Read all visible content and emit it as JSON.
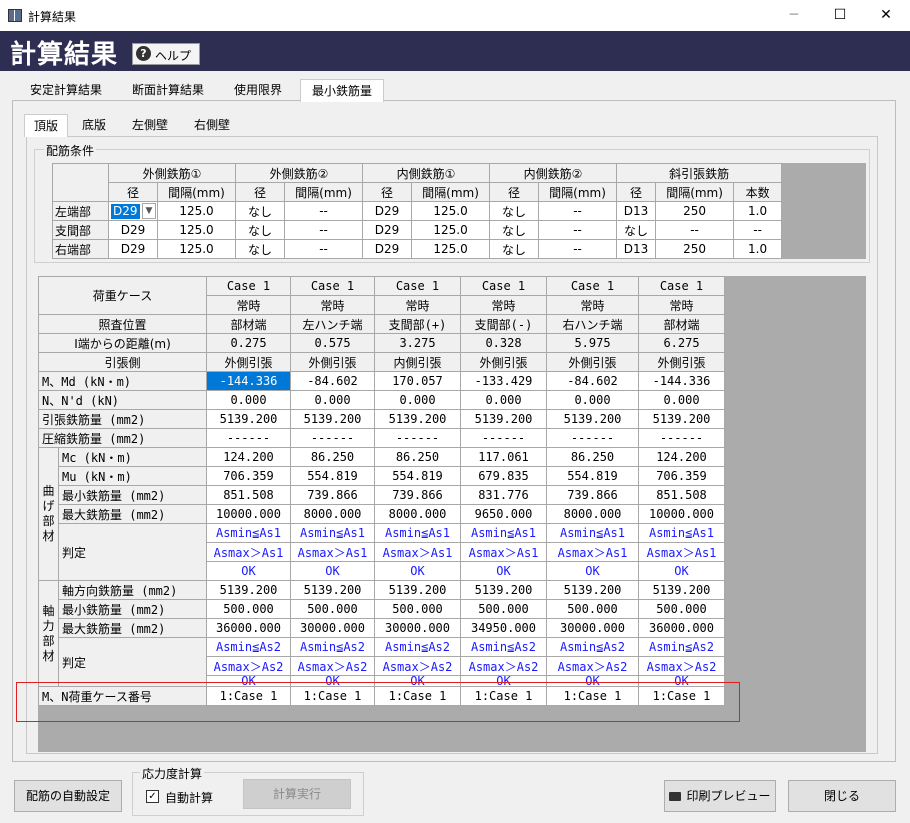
{
  "window": {
    "title": "計算結果",
    "header": "計算結果",
    "help_label": "ヘルプ",
    "minimize": "─",
    "maximize": "☐",
    "close": "✕"
  },
  "main_tabs": [
    "安定計算結果",
    "断面計算結果",
    "使用限界",
    "最小鉄筋量"
  ],
  "sub_tabs": [
    "頂版",
    "底版",
    "左側壁",
    "右側壁"
  ],
  "rebar": {
    "group_label": "配筋条件",
    "groups": [
      "外側鉄筋①",
      "外側鉄筋②",
      "内側鉄筋①",
      "内側鉄筋②",
      "斜引張鉄筋"
    ],
    "sub": {
      "dia": "径",
      "pitch": "間隔(mm)",
      "count": "本数"
    },
    "rows": [
      {
        "label": "左端部",
        "v": [
          "D29",
          "125.0",
          "なし",
          "--",
          "D29",
          "125.0",
          "なし",
          "--",
          "D13",
          "250",
          "1.0"
        ]
      },
      {
        "label": "支間部",
        "v": [
          "D29",
          "125.0",
          "なし",
          "--",
          "D29",
          "125.0",
          "なし",
          "--",
          "なし",
          "--",
          "--"
        ]
      },
      {
        "label": "右端部",
        "v": [
          "D29",
          "125.0",
          "なし",
          "--",
          "D29",
          "125.0",
          "なし",
          "--",
          "D13",
          "250",
          "1.0"
        ]
      }
    ]
  },
  "results": {
    "load_case_label": "荷重ケース",
    "case": [
      "Case 1",
      "Case 1",
      "Case 1",
      "Case 1",
      "Case 1",
      "Case 1"
    ],
    "cond": [
      "常時",
      "常時",
      "常時",
      "常時",
      "常時",
      "常時"
    ],
    "position_label": "照査位置",
    "position": [
      "部材端",
      "左ハンチ端",
      "支間部(+)",
      "支間部(-)",
      "右ハンチ端",
      "部材端"
    ],
    "dist_label": "I端からの距離(m)",
    "dist": [
      "0.275",
      "0.575",
      "3.275",
      "0.328",
      "5.975",
      "6.275"
    ],
    "tension_label": "引張側",
    "tension": [
      "外側引張",
      "外側引張",
      "内側引張",
      "外側引張",
      "外側引張",
      "外側引張"
    ],
    "m_label": "M、Md  (kN・m)",
    "m": [
      "-144.336",
      "-84.602",
      "170.057",
      "-133.429",
      "-84.602",
      "-144.336"
    ],
    "n_label": "N、N'd (kN)",
    "n": [
      "0.000",
      "0.000",
      "0.000",
      "0.000",
      "0.000",
      "0.000"
    ],
    "as_label": "引張鉄筋量 (mm2)",
    "as": [
      "5139.200",
      "5139.200",
      "5139.200",
      "5139.200",
      "5139.200",
      "5139.200"
    ],
    "asc_label": "圧縮鉄筋量 (mm2)",
    "asc": [
      "------",
      "------",
      "------",
      "------",
      "------",
      "------"
    ],
    "bend_section": "曲げ部材",
    "mc_label": "Mc (kN・m)",
    "mc": [
      "124.200",
      "86.250",
      "86.250",
      "117.061",
      "86.250",
      "124.200"
    ],
    "mu_label": "Mu (kN・m)",
    "mu": [
      "706.359",
      "554.819",
      "554.819",
      "679.835",
      "554.819",
      "706.359"
    ],
    "bmin_label": "最小鉄筋量 (mm2)",
    "bmin": [
      "851.508",
      "739.866",
      "739.866",
      "831.776",
      "739.866",
      "851.508"
    ],
    "bmax_label": "最大鉄筋量 (mm2)",
    "bmax": [
      "10000.000",
      "8000.000",
      "8000.000",
      "9650.000",
      "8000.000",
      "10000.000"
    ],
    "judge_label": "判定",
    "bj1": [
      "Asmin≦As1",
      "Asmin≦As1",
      "Asmin≦As1",
      "Asmin≦As1",
      "Asmin≦As1",
      "Asmin≦As1"
    ],
    "bj2": [
      "Asmax＞As1",
      "Asmax＞As1",
      "Asmax＞As1",
      "Asmax＞As1",
      "Asmax＞As1",
      "Asmax＞As1"
    ],
    "bj3": [
      "OK",
      "OK",
      "OK",
      "OK",
      "OK",
      "OK"
    ],
    "axial_section": "軸力部材",
    "ax_label": "軸方向鉄筋量 (mm2)",
    "ax": [
      "5139.200",
      "5139.200",
      "5139.200",
      "5139.200",
      "5139.200",
      "5139.200"
    ],
    "amin_label": "最小鉄筋量  (mm2)",
    "amin": [
      "500.000",
      "500.000",
      "500.000",
      "500.000",
      "500.000",
      "500.000"
    ],
    "amax_label": "最大鉄筋量  (mm2)",
    "amax": [
      "36000.000",
      "30000.000",
      "30000.000",
      "34950.000",
      "30000.000",
      "36000.000"
    ],
    "aj1": [
      "Asmin≦As2",
      "Asmin≦As2",
      "Asmin≦As2",
      "Asmin≦As2",
      "Asmin≦As2",
      "Asmin≦As2"
    ],
    "aj2": [
      "Asmax＞As2",
      "Asmax＞As2",
      "Asmax＞As2",
      "Asmax＞As2",
      "Asmax＞As2",
      "Asmax＞As2"
    ],
    "aj3": [
      "OK",
      "OK",
      "OK",
      "OK",
      "OK",
      "OK"
    ],
    "mn_label": "M、N荷重ケース番号",
    "mn": [
      "1:Case 1",
      "1:Case 1",
      "1:Case 1",
      "1:Case 1",
      "1:Case 1",
      "1:Case 1"
    ]
  },
  "footer": {
    "auto_rebar": "配筋の自動設定",
    "stress_group": "応力度計算",
    "auto_calc": "自動計算",
    "calc_exec": "計算実行",
    "print_preview": "印刷プレビュー",
    "close": "閉じる"
  }
}
